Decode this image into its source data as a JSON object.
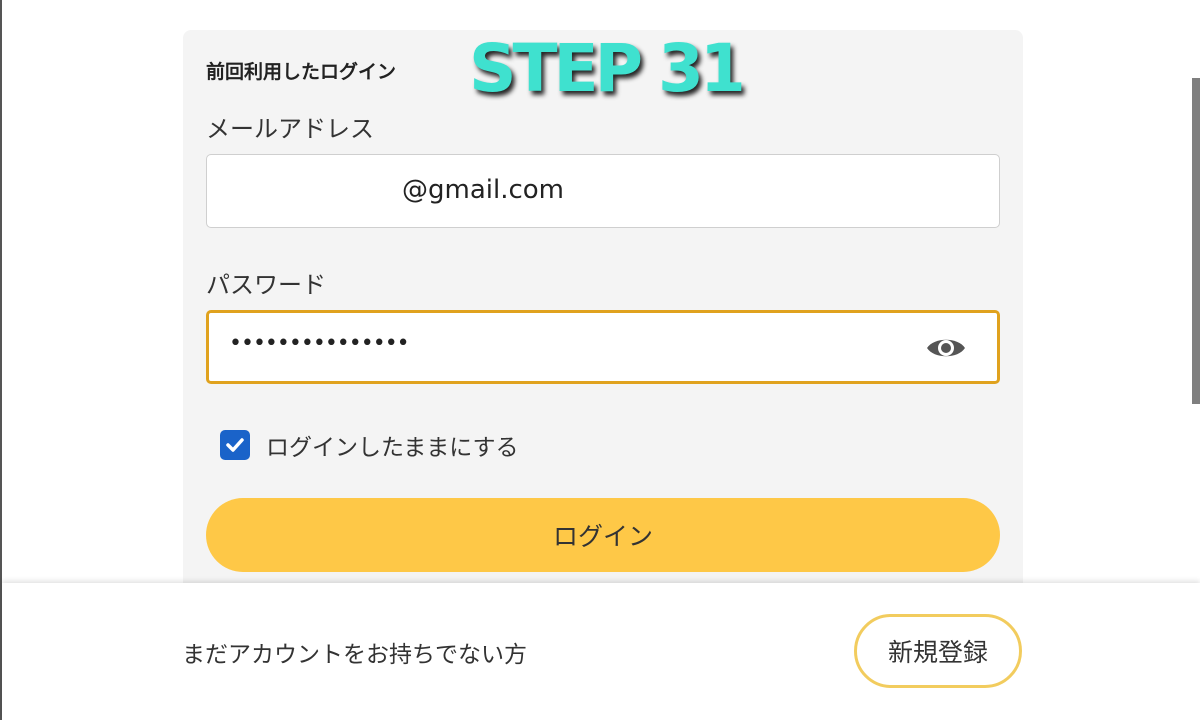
{
  "overlay": {
    "step_label": "STEP 31"
  },
  "login_card": {
    "section_title": "前回利用したログイン",
    "email": {
      "label": "メールアドレス",
      "value": "@gmail.com"
    },
    "password": {
      "label": "パスワード",
      "masked_value": "•••••••••••••••",
      "toggle_icon": "eye-icon"
    },
    "remember_me": {
      "label": "ログインしたままにする",
      "checked": true
    },
    "login_button_label": "ログイン"
  },
  "footer": {
    "prompt_text": "まだアカウントをお持ちでない方",
    "register_button_label": "新規登録"
  },
  "colors": {
    "card_background": "#f4f4f4",
    "accent_yellow": "#fec847",
    "focus_border": "#e0a21e",
    "checkbox_blue": "#1a63c9",
    "overlay_teal": "#3fe1cf"
  }
}
